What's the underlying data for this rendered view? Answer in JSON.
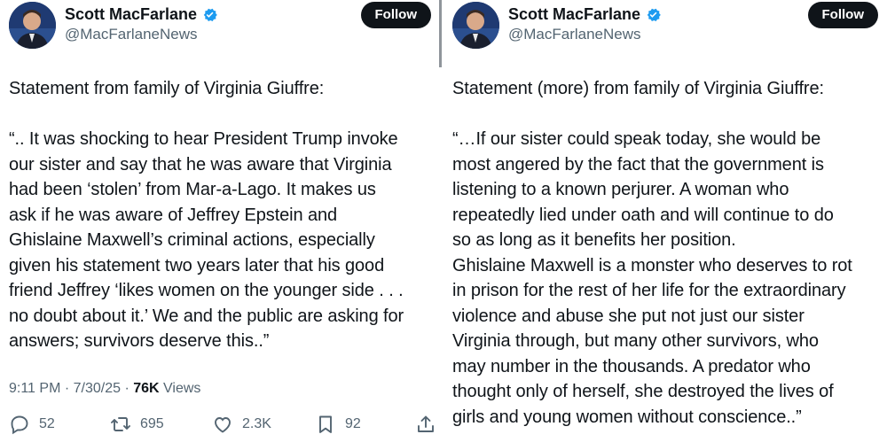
{
  "left": {
    "author": {
      "name": "Scott MacFarlane",
      "handle": "@MacFarlaneNews"
    },
    "follow_label": "Follow",
    "text": "Statement from family of Virginia Giuffre:\n\n“.. It was shocking to hear President Trump invoke\nour sister and say that he was aware that Virginia\nhad been ‘stolen’ from Mar-a-Lago. It makes us\nask if he was aware of Jeffrey Epstein and\nGhislaine Maxwell’s criminal actions, especially\ngiven his statement two years later that his good\nfriend Jeffrey ‘likes women on the younger side . . .\nno doubt about it.’ We and the public are asking for\nanswers; survivors deserve this..”",
    "timestamp": "9:11 PM · 7/30/25 · ",
    "views_count": "76K",
    "views_label": " Views",
    "actions": {
      "replies": "52",
      "reposts": "695",
      "likes": "2.3K",
      "bookmarks": "92"
    }
  },
  "right": {
    "author": {
      "name": "Scott MacFarlane",
      "handle": "@MacFarlaneNews"
    },
    "follow_label": "Follow",
    "text": "Statement (more) from family of Virginia Giuffre:\n\n“…If our sister could speak today, she would be\nmost angered by the fact that the government is\nlistening to a known perjurer. A woman who\nrepeatedly lied under oath and will continue to do\nso as long as it benefits her position.\nGhislaine Maxwell is a monster who deserves to rot\nin prison for the rest of her life for the extraordinary\nviolence and abuse she put not just our sister\nVirginia through, but many other survivors, who\nmay number in the thousands. A predator who\nthought only of herself, she destroyed the lives of\ngirls and young women without conscience..”"
  },
  "colors": {
    "verified": "#1d9bf0",
    "follow_bg": "#0f1419",
    "secondary_text": "#536471"
  },
  "icons": [
    "verified-badge-icon",
    "reply-icon",
    "repost-icon",
    "like-icon",
    "bookmark-icon",
    "share-icon"
  ]
}
